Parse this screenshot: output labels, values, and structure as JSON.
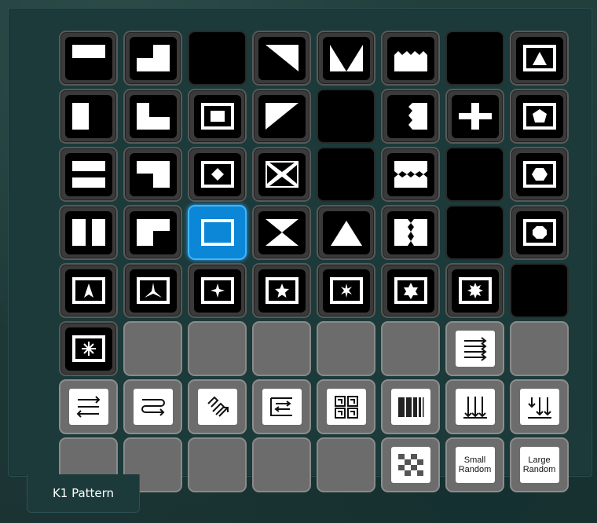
{
  "panel": {
    "title": "K1 Pattern"
  },
  "grid": {
    "rows": [
      [
        "wipe-horizontal-bar",
        "wipe-corner-top-right",
        "blank",
        "wipe-diagonal-top-right",
        "wipe-v-down",
        "wipe-zigzag-top",
        "blank",
        "wipe-triangle-up-small"
      ],
      [
        "wipe-vertical-bar-left",
        "wipe-corner-bottom-right",
        "wipe-box-square",
        "wipe-diagonal-bottom-right",
        "blank",
        "wipe-zigzag-left",
        "wipe-cross",
        "wipe-pentagon"
      ],
      [
        "wipe-horizontal-split",
        "wipe-corner-bottom-left",
        "wipe-diamond",
        "wipe-x-cross",
        "blank",
        "wipe-zigzag-horizontal",
        "blank",
        "wipe-hexagon"
      ],
      [
        "wipe-vertical-split",
        "wipe-corner-top-left-white",
        "wipe-box-outline-selected",
        "wipe-bowtie",
        "wipe-triangle-up-large",
        "wipe-zigzag-vertical",
        "blank",
        "wipe-octagon"
      ],
      [
        "wipe-star-3-point",
        "wipe-star-3-point-alt",
        "wipe-star-4-point",
        "wipe-star-5-point",
        "wipe-star-6-point",
        "wipe-star-6-point-alt",
        "wipe-star-8-point",
        "blank"
      ],
      [
        "wipe-star-burst",
        "empty",
        "empty",
        "empty",
        "empty",
        "empty",
        "transition-arrows-right",
        "empty"
      ],
      [
        "transition-arrows-both",
        "transition-loop-arrows",
        "transition-diagonal-arrows",
        "transition-reverse-arrows",
        "transition-blocks",
        "transition-bars",
        "transition-arrows-down",
        "transition-arrows-down-up"
      ],
      [
        "empty",
        "empty",
        "empty",
        "empty",
        "empty",
        "transition-checkerboard",
        "transition-small-random",
        "transition-large-random"
      ]
    ],
    "labels": {
      "small_random": "Small\nRandom",
      "large_random": "Large\nRandom"
    }
  }
}
